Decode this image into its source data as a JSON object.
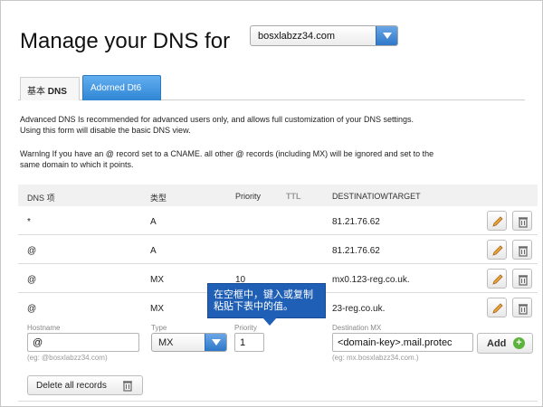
{
  "page": {
    "title": "Manage your DNS for",
    "domain_select_value": "bosxlabzz34.com"
  },
  "tabs": [
    {
      "label_cn": "基本",
      "label_en": "DNS"
    },
    {
      "label": "Adorned Dt6"
    }
  ],
  "info": {
    "line1": "Advanced DNS Is recommended for advanced users only, and allows full customization of your DNS settings.",
    "line2": "Using this form will disable the basic DNS view.",
    "warning1": "Warnlng If you have an @ record set to a CNAME. all other @ records (including MX) will be ignored and set to the",
    "warning2": "same domain to which it points."
  },
  "table": {
    "headers": [
      "DNS 项",
      "类型",
      "Priority",
      "TTL",
      "DESTINATIOWTARGET"
    ],
    "rows": [
      {
        "host": "*",
        "type": "A",
        "priority": "",
        "destination": "81.21.76.62"
      },
      {
        "host": "@",
        "type": "A",
        "priority": "",
        "destination": "81.21.76.62"
      },
      {
        "host": "@",
        "type": "MX",
        "priority": "10",
        "destination": "mx0.123-reg.co.uk."
      },
      {
        "host": "@",
        "type": "MX",
        "priority": "",
        "destination": "23-reg.co.uk."
      }
    ]
  },
  "form": {
    "hostname_label": "Hostname",
    "hostname_value": "@",
    "hostname_hint": "(eg: @bosxlabzz34.com)",
    "type_label": "Type",
    "type_value": "MX",
    "priority_label": "Priority",
    "priority_value": "1",
    "destination_label": "Destination MX",
    "destination_value": "<domain-key>.mail.protec",
    "destination_hint": "(eg: mx.bosxlabzz34.com.)",
    "add_label": "Add",
    "add_icon": "+"
  },
  "delete_all_label": "Delete all records",
  "callout": {
    "line1": "在空框中，键入或复制",
    "line2": "粘贴下表中的值。"
  },
  "colors": {
    "accent_blue": "#2f86d4",
    "callout_blue": "#1f5fb5",
    "add_green": "#5ab33a"
  },
  "icons": [
    "chevron-down-icon",
    "pencil-icon",
    "trash-icon",
    "plus-icon"
  ]
}
